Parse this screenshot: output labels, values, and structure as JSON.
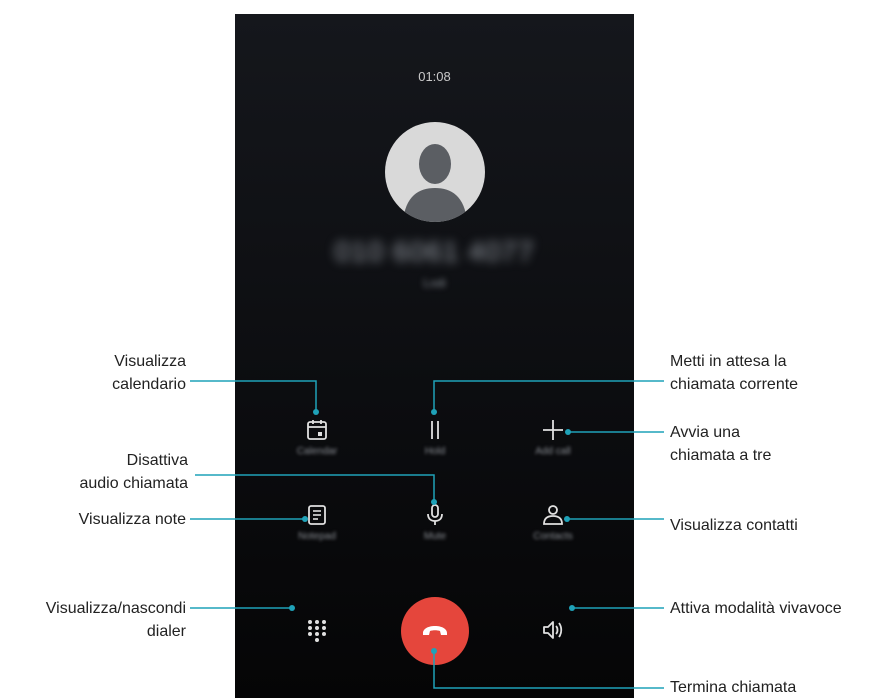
{
  "call": {
    "timer": "01:08",
    "number": "010 6061 4077",
    "location": "Lodi"
  },
  "controls": {
    "calendar": "Calendar",
    "hold": "Hold",
    "add_call": "Add call",
    "notepad": "Notepad",
    "mute": "Mute",
    "contacts": "Contacts"
  },
  "callouts": {
    "calendar_1": "Visualizza",
    "calendar_2": "calendario",
    "hold_1": "Metti in attesa la",
    "hold_2": "chiamata corrente",
    "add_1": "Avvia una",
    "add_2": "chiamata a tre",
    "mute_1": "Disattiva",
    "mute_2": "audio chiamata",
    "notes": "Visualizza note",
    "contacts": "Visualizza contatti",
    "dialer_1": "Visualizza/nascondi",
    "dialer_2": "dialer",
    "speaker": "Attiva modalità vivavoce",
    "end": "Termina chiamata"
  },
  "colors": {
    "accent_line": "#1fa2b8",
    "end_call": "#e5463c"
  }
}
